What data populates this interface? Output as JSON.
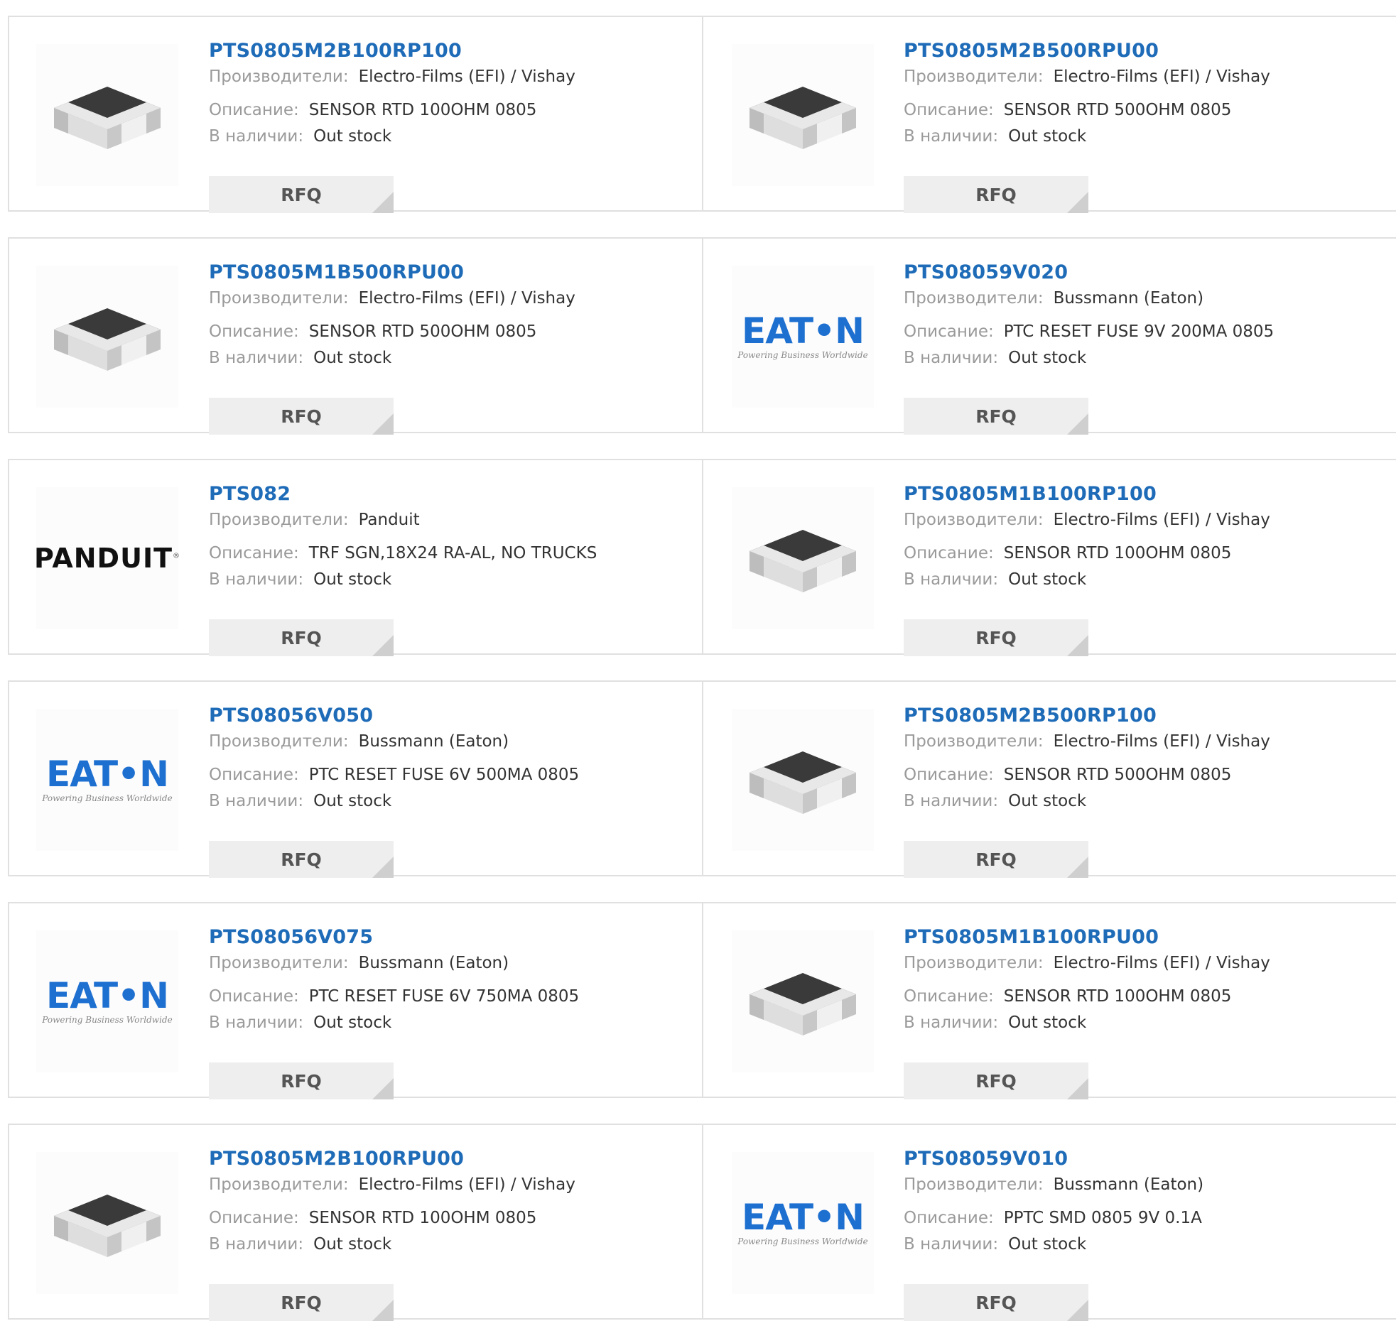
{
  "labels": {
    "manufacturer": "Производители:",
    "description": "Описание:",
    "stock": "В наличии:",
    "rfq": "RFQ"
  },
  "colors": {
    "link": "#1e6bb8",
    "eaton_blue": "#1d6fd0"
  },
  "products": [
    {
      "part": "PTS0805M2B100RP100",
      "manufacturer": "Electro-Films (EFI) / Vishay",
      "description": "SENSOR RTD 100OHM 0805",
      "stock": "Out stock",
      "image": "chip-resistor"
    },
    {
      "part": "PTS0805M2B500RPU00",
      "manufacturer": "Electro-Films (EFI) / Vishay",
      "description": "SENSOR RTD 500OHM 0805",
      "stock": "Out stock",
      "image": "chip-resistor"
    },
    {
      "part": "PTS0805M1B500RPU00",
      "manufacturer": "Electro-Films (EFI) / Vishay",
      "description": "SENSOR RTD 500OHM 0805",
      "stock": "Out stock",
      "image": "chip-resistor"
    },
    {
      "part": "PTS08059V020",
      "manufacturer": "Bussmann (Eaton)",
      "description": "PTC RESET FUSE 9V 200MA 0805",
      "stock": "Out stock",
      "image": "eaton-logo"
    },
    {
      "part": "PTS082",
      "manufacturer": "Panduit",
      "description": "TRF SGN,18X24 RA-AL, NO TRUCKS",
      "stock": "Out stock",
      "image": "panduit-logo"
    },
    {
      "part": "PTS0805M1B100RP100",
      "manufacturer": "Electro-Films (EFI) / Vishay",
      "description": "SENSOR RTD 100OHM 0805",
      "stock": "Out stock",
      "image": "chip-resistor"
    },
    {
      "part": "PTS08056V050",
      "manufacturer": "Bussmann (Eaton)",
      "description": "PTC RESET FUSE 6V 500MA 0805",
      "stock": "Out stock",
      "image": "eaton-logo"
    },
    {
      "part": "PTS0805M2B500RP100",
      "manufacturer": "Electro-Films (EFI) / Vishay",
      "description": "SENSOR RTD 500OHM 0805",
      "stock": "Out stock",
      "image": "chip-resistor"
    },
    {
      "part": "PTS08056V075",
      "manufacturer": "Bussmann (Eaton)",
      "description": "PTC RESET FUSE 6V 750MA 0805",
      "stock": "Out stock",
      "image": "eaton-logo"
    },
    {
      "part": "PTS0805M1B100RPU00",
      "manufacturer": "Electro-Films (EFI) / Vishay",
      "description": "SENSOR RTD 100OHM 0805",
      "stock": "Out stock",
      "image": "chip-resistor"
    },
    {
      "part": "PTS0805M2B100RPU00",
      "manufacturer": "Electro-Films (EFI) / Vishay",
      "description": "SENSOR RTD 100OHM 0805",
      "stock": "Out stock",
      "image": "chip-resistor"
    },
    {
      "part": "PTS08059V010",
      "manufacturer": "Bussmann (Eaton)",
      "description": "PPTC SMD 0805 9V 0.1A",
      "stock": "Out stock",
      "image": "eaton-logo"
    }
  ],
  "logos": {
    "eaton": {
      "word": "EAT•N",
      "tagline": "Powering Business Worldwide"
    },
    "panduit": {
      "word": "PANDUIT",
      "mark": "®"
    }
  }
}
